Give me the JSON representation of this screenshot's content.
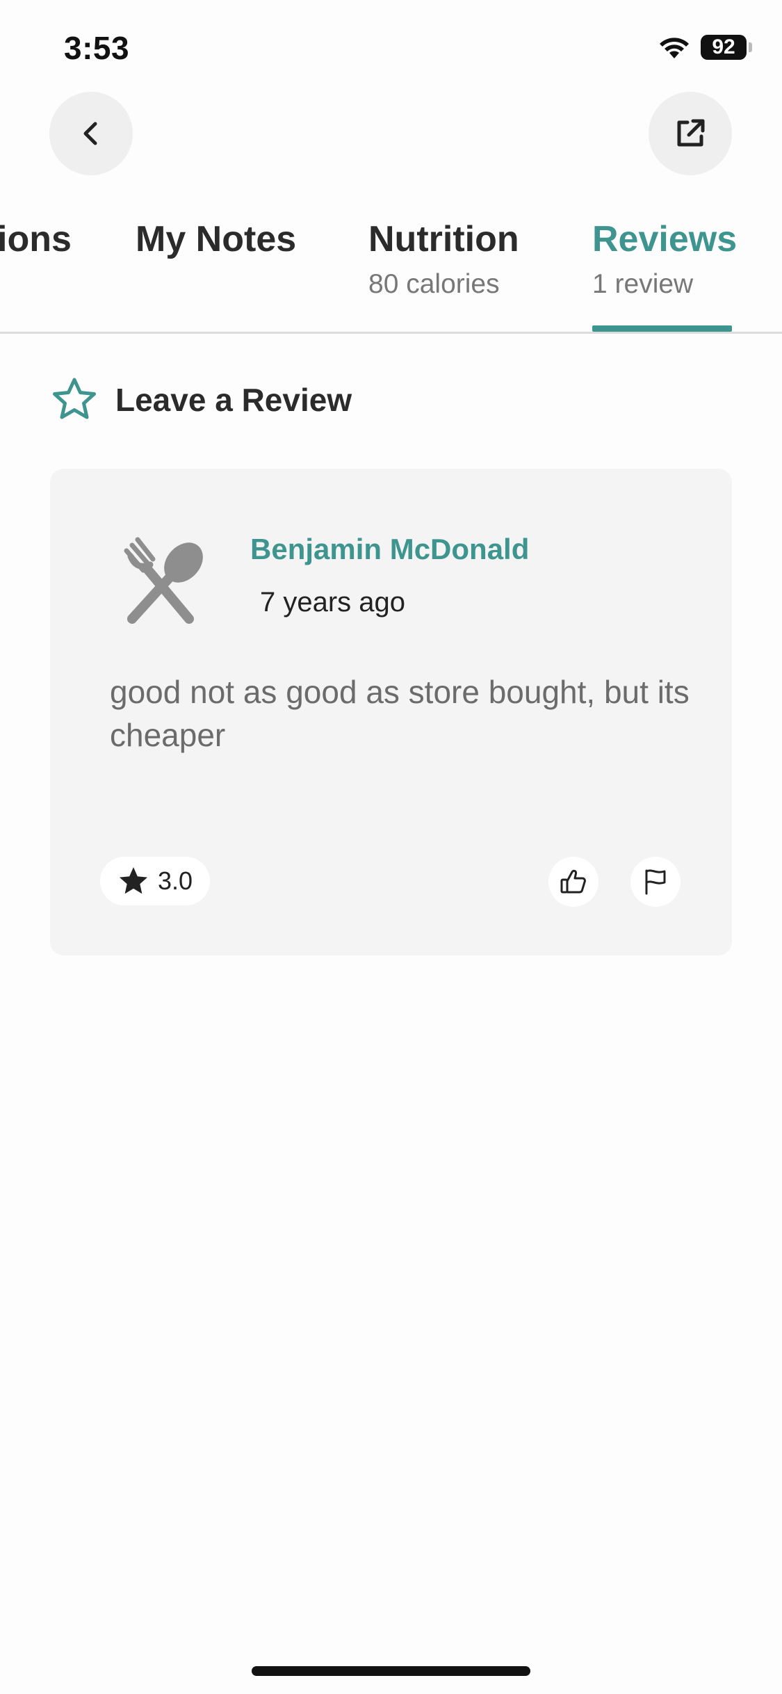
{
  "status_bar": {
    "time": "3:53",
    "battery": "92"
  },
  "header": {
    "back_icon": "chevron-left-icon",
    "share_icon": "external-link-icon"
  },
  "tabs": [
    {
      "title": "ions",
      "subtitle": ""
    },
    {
      "title": "My Notes",
      "subtitle": ""
    },
    {
      "title": "Nutrition",
      "subtitle": "80 calories"
    },
    {
      "title": "Reviews",
      "subtitle": "1 review",
      "active": true
    }
  ],
  "leave_review": {
    "label": "Leave a Review",
    "icon": "star-outline-icon"
  },
  "review": {
    "avatar_icon": "fork-spoon-icon",
    "name": "Benjamin McDonald",
    "time": "7 years ago",
    "text": "good not as good as store bought, but its cheaper",
    "rating": "3.0",
    "like_icon": "thumbs-up-icon",
    "flag_icon": "flag-icon"
  },
  "colors": {
    "accent": "#3e948e",
    "card_bg": "#f4f4f4",
    "button_bg": "#efefef"
  }
}
